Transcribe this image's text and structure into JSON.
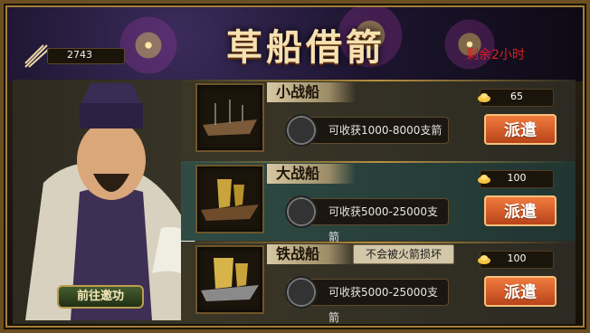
{
  "header": {
    "title": "草船借箭",
    "remaining_time": "剩余2小时",
    "arrow_count": "2743",
    "arrow_icon": "arrows-icon"
  },
  "ships": [
    {
      "name": "小战船",
      "cost": "65",
      "capacity": "可收获1000-8000支箭",
      "button": "派遣",
      "icon": "small-boat-icon"
    },
    {
      "name": "大战船",
      "cost": "100",
      "capacity": "可收获5000-25000支箭",
      "button": "派遣",
      "icon": "large-boat-icon"
    },
    {
      "name": "铁战船",
      "cost": "100",
      "capacity": "可收获5000-25000支箭",
      "button": "派遣",
      "note": "不会被火箭损坏",
      "icon": "iron-boat-icon"
    }
  ],
  "hero": {
    "button": "前往邀功"
  },
  "colors": {
    "accent": "#e21d1d",
    "gold": "#f7e1b0",
    "button": "#f07b3d"
  }
}
